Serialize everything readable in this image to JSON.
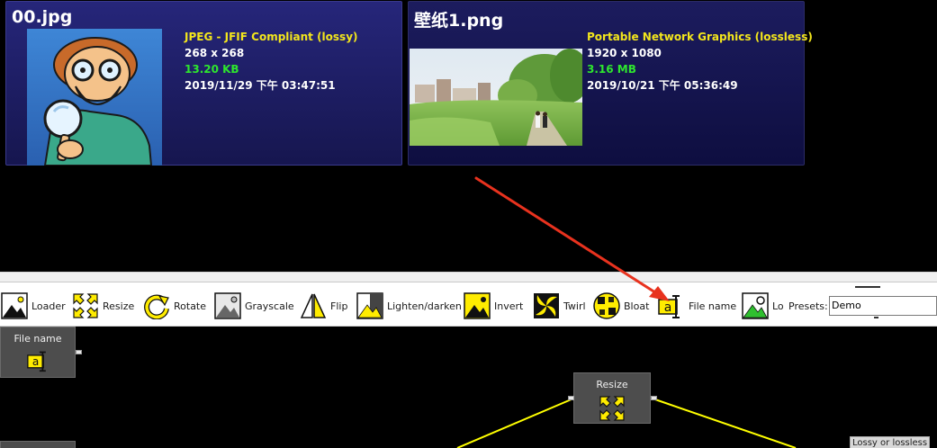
{
  "thumbnails": [
    {
      "filename": "00.jpg",
      "format": "JPEG - JFIF Compliant (lossy)",
      "dimensions": "268 x 268",
      "filesize": "13.20 KB",
      "date": "2019/11/29 下午 03:47:51"
    },
    {
      "filename": "壁纸1.png",
      "format": "Portable Network Graphics (lossless)",
      "dimensions": "1920 x 1080",
      "filesize": "3.16 MB",
      "date": "2019/10/21 下午 05:36:49"
    }
  ],
  "toolbar": {
    "tools": [
      {
        "label": "Loader",
        "icon": "loader-icon"
      },
      {
        "label": "Resize",
        "icon": "resize-icon"
      },
      {
        "label": "Rotate",
        "icon": "rotate-icon"
      },
      {
        "label": "Grayscale",
        "icon": "grayscale-icon"
      },
      {
        "label": "Flip",
        "icon": "flip-icon"
      },
      {
        "label": "Lighten/darken",
        "icon": "lighten-darken-icon"
      },
      {
        "label": "Invert",
        "icon": "invert-icon"
      },
      {
        "label": "Twirl",
        "icon": "twirl-icon"
      },
      {
        "label": "Bloat",
        "icon": "bloat-icon"
      },
      {
        "label": "File name",
        "icon": "file-name-icon"
      },
      {
        "label": "Lo",
        "icon": "lossy-lossless-icon"
      }
    ],
    "presets_label": "Presets:",
    "presets_value": "Demo"
  },
  "graph": {
    "nodes": [
      {
        "title": "File name",
        "icon": "file-name-icon"
      },
      {
        "title": "Resize",
        "icon": "resize-icon"
      }
    ],
    "partial_node_label": "Lossy or lossless"
  },
  "colors": {
    "format_text": "#f3e61c",
    "filesize_text": "#2ee62e",
    "card_background": "#1c1c5e",
    "annotation_arrow": "#e8321e",
    "connection_line": "#ffff00",
    "node_background": "#4d4d4d"
  }
}
